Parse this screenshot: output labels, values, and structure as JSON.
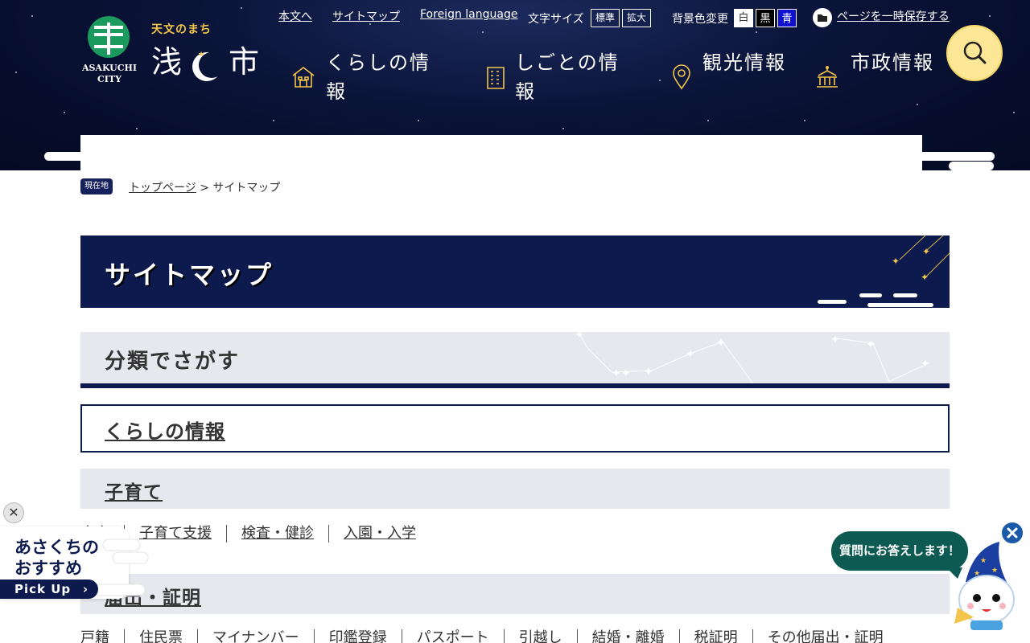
{
  "header": {
    "logo": {
      "en_line1": "ASAKUCHI",
      "en_line2": "CITY",
      "tagline": "天文のまち",
      "name_left": "浅",
      "name_right": "市"
    },
    "utility": {
      "skip": "本文へ",
      "sitemap": "サイトマップ",
      "foreign": "Foreign language",
      "font_size_label": "文字サイズ",
      "font_standard": "標準",
      "font_large": "拡大",
      "bg_label": "背景色変更",
      "bg_white": "白",
      "bg_black": "黒",
      "bg_blue": "青",
      "save_page": "ページを一時保存する"
    },
    "nav": [
      {
        "label": "くらしの情報",
        "icon": "house-icon"
      },
      {
        "label": "しごとの情報",
        "icon": "building-icon"
      },
      {
        "label": "観光情報",
        "icon": "map-pin-icon"
      },
      {
        "label": "市政情報",
        "icon": "city-hall-icon"
      }
    ],
    "colors": {
      "accent": "#f3c54a",
      "navy": "#0c1a4e",
      "search_bg": "#fbe796"
    }
  },
  "breadcrumb": {
    "badge": "現在地",
    "home": "トップページ",
    "sep": ">",
    "current": "サイトマップ"
  },
  "page": {
    "title": "サイトマップ",
    "section_title": "分類でさがす",
    "category": "くらしの情報",
    "subsections": [
      {
        "title": "子育て",
        "links": [
          "出産",
          "子育て支援",
          "検査・健診",
          "入園・入学"
        ]
      },
      {
        "title": "届出・証明",
        "links": [
          "戸籍",
          "住民票",
          "マイナンバー",
          "印鑑登録",
          "パスポート",
          "引越し",
          "結婚・離婚",
          "税証明",
          "その他届出・証明"
        ]
      }
    ]
  },
  "pickup": {
    "line1": "あさくちの",
    "line2": "おすすめ",
    "button": "Pick Up"
  },
  "chatbot": {
    "bubble": "質問にお答えします！"
  }
}
